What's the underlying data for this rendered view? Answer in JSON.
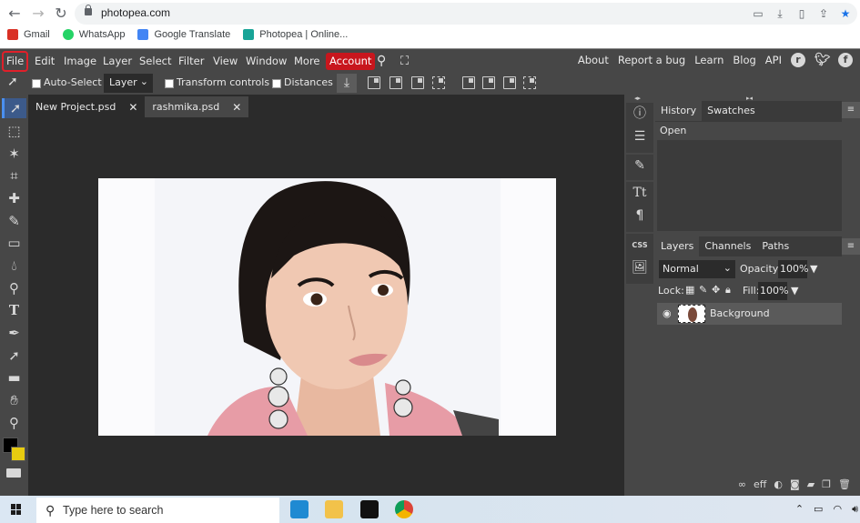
{
  "browser": {
    "url": "photopea.com",
    "nav": {
      "back": "←",
      "forward": "→",
      "reload": "↻"
    },
    "bookmarks": [
      {
        "label": "Gmail",
        "icon": "gmail-icon",
        "color": "#d93025"
      },
      {
        "label": "WhatsApp",
        "icon": "whatsapp-icon",
        "color": "#25d366"
      },
      {
        "label": "Google Translate",
        "icon": "google-translate-icon",
        "color": "#4285f4"
      },
      {
        "label": "Photopea | Online...",
        "icon": "photopea-icon",
        "color": "#18a497"
      }
    ]
  },
  "menubar": {
    "items": [
      "File",
      "Edit",
      "Image",
      "Layer",
      "Select",
      "Filter",
      "View",
      "Window",
      "More"
    ],
    "account": "Account",
    "right_links": [
      "About",
      "Report a bug",
      "Learn",
      "Blog",
      "API"
    ],
    "highlighted": "File",
    "colors": {
      "account_bg": "#c8161d",
      "highlight_outline": "#e0202a"
    }
  },
  "options": {
    "auto_select": {
      "label": "Auto-Select",
      "checked": false
    },
    "target": "Layer",
    "transform_controls": {
      "label": "Transform controls",
      "checked": false
    },
    "distances": {
      "label": "Distances",
      "checked": false
    }
  },
  "tabs": [
    {
      "label": "New Project.psd",
      "active": false,
      "close": "✕"
    },
    {
      "label": "rashmika.psd",
      "active": true,
      "close": "✕"
    }
  ],
  "tools": [
    "move-tool",
    "marquee-tool",
    "magic-wand-tool",
    "crop-tool",
    "healing-tool",
    "brush-tool",
    "gradient-tool",
    "blur-tool",
    "dodge-tool",
    "type-tool",
    "pen-tool",
    "path-select-tool",
    "shape-tool",
    "hand-tool",
    "zoom-tool"
  ],
  "colors": {
    "foreground": "#000000",
    "background": "#e8cc10"
  },
  "history_panel": {
    "tabs": [
      "History",
      "Swatches"
    ],
    "active_tab": "History",
    "entries": [
      "Open"
    ]
  },
  "layers_panel": {
    "tabs": [
      "Layers",
      "Channels",
      "Paths"
    ],
    "active_tab": "Layers",
    "blend_mode": "Normal",
    "opacity_label": "Opacity:",
    "opacity": "100%",
    "lock_label": "Lock:",
    "fill_label": "Fill:",
    "fill": "100%",
    "layers": [
      {
        "name": "Background",
        "visible": true
      }
    ],
    "bottom_buttons": [
      "link-layers",
      "effects",
      "adjustment",
      "mask",
      "group",
      "new-layer",
      "delete"
    ]
  },
  "taskbar": {
    "search_placeholder": "Type here to search",
    "apps": [
      "vscode",
      "file-explorer",
      "terminal",
      "chrome"
    ]
  }
}
